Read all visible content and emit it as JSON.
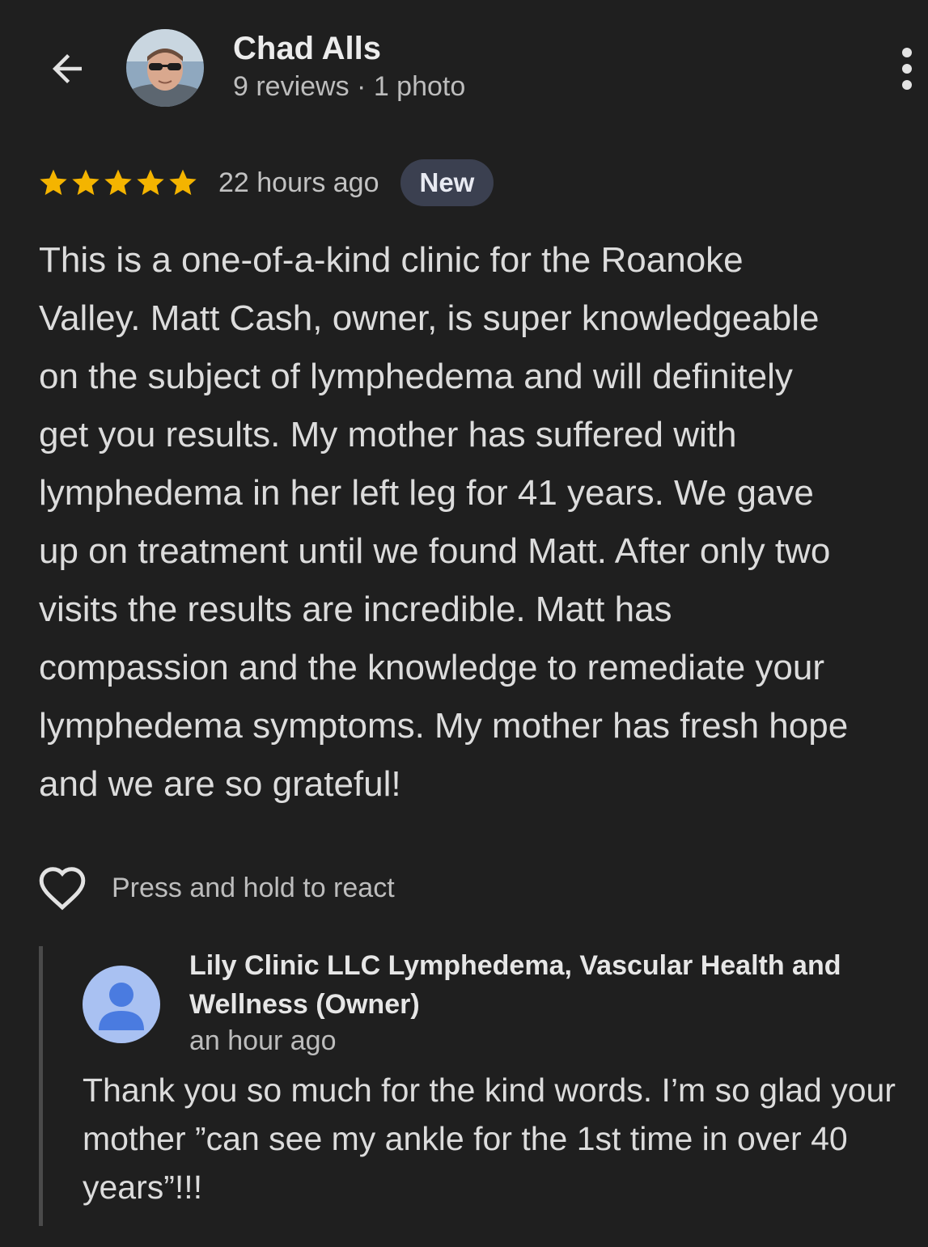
{
  "header": {
    "reviewer_name": "Chad Alls",
    "reviewer_meta": "9 reviews · 1 photo"
  },
  "review": {
    "rating": 5,
    "rating_max": 5,
    "time_ago": "22 hours ago",
    "badge": "New",
    "lines": [
      "This is a one-of-a-kind clinic for the Roanoke",
      "Valley. Matt Cash, owner, is super knowledgeable",
      "on the subject of lymphedema and will definitely",
      "get you results. My mother has suffered with",
      "lymphedema in her left leg for 41 years. We gave",
      "up on treatment until we found Matt. After only two",
      "visits the results are incredible. Matt has",
      "compassion and the knowledge to remediate your",
      "lymphedema symptoms. My mother has fresh hope",
      "and we are so grateful!"
    ]
  },
  "react": {
    "label": "Press and hold to react",
    "icon": "heart-outline-icon"
  },
  "owner_reply": {
    "name_line_1": "Lily Clinic LLC Lymphedema, Vascular Health and",
    "name_line_2": "Wellness (Owner)",
    "time_ago": "an hour ago",
    "lines": [
      "Thank you so much for the kind words. I’m so glad your",
      "mother ”can see my ankle for the 1st time in over 40",
      "years”!!!"
    ]
  },
  "colors": {
    "background": "#1f1f1f",
    "star": "#f4b400",
    "badge_bg": "#3b4050",
    "owner_avatar_bg": "#a9c1f2",
    "owner_avatar_fg": "#4a7be0"
  }
}
